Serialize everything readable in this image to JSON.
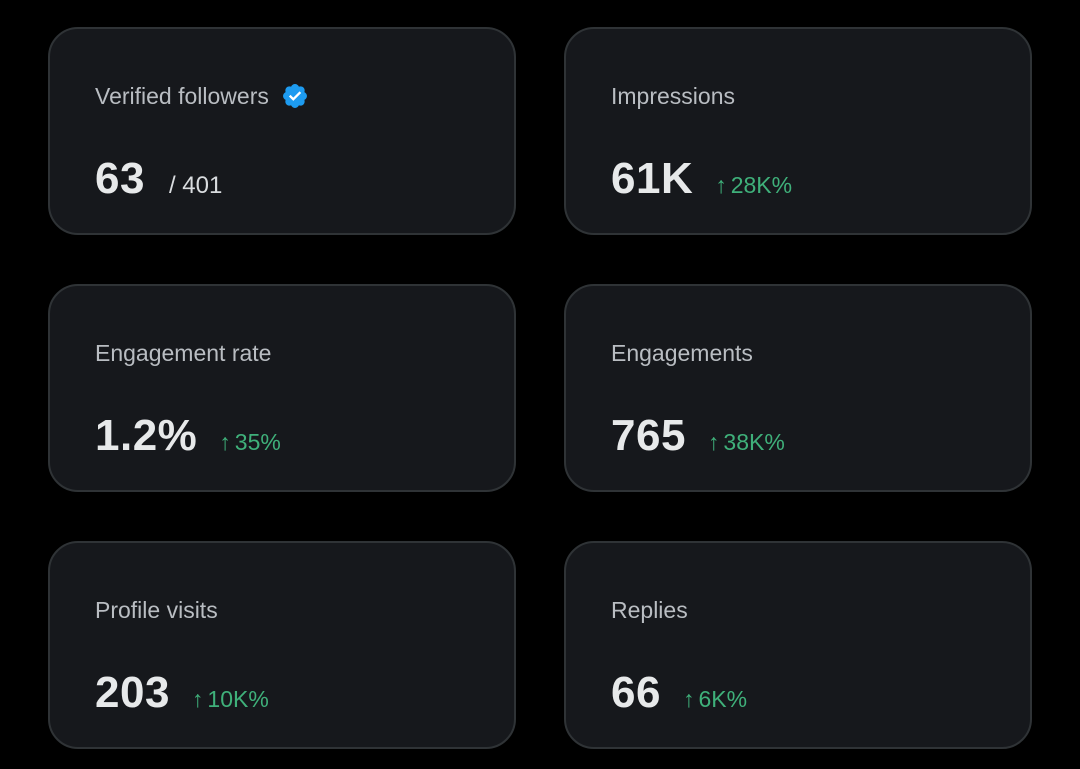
{
  "colors": {
    "background": "#000000",
    "card": "#16181c",
    "card_border": "#2f3336",
    "label": "#b9bdc2",
    "value": "#e7e9ea",
    "positive": "#3fb07a",
    "verified_badge": "#1d9bf0"
  },
  "cards": [
    {
      "label": "Verified followers",
      "value": "63",
      "sub": "/ 401",
      "icon": "verified-badge-icon"
    },
    {
      "label": "Impressions",
      "value": "61K",
      "delta": {
        "arrow": "↑",
        "text": "28K%"
      }
    },
    {
      "label": "Engagement rate",
      "value": "1.2%",
      "delta": {
        "arrow": "↑",
        "text": "35%"
      }
    },
    {
      "label": "Engagements",
      "value": "765",
      "delta": {
        "arrow": "↑",
        "text": "38K%"
      }
    },
    {
      "label": "Profile visits",
      "value": "203",
      "delta": {
        "arrow": "↑",
        "text": "10K%"
      }
    },
    {
      "label": "Replies",
      "value": "66",
      "delta": {
        "arrow": "↑",
        "text": "6K%"
      }
    }
  ]
}
